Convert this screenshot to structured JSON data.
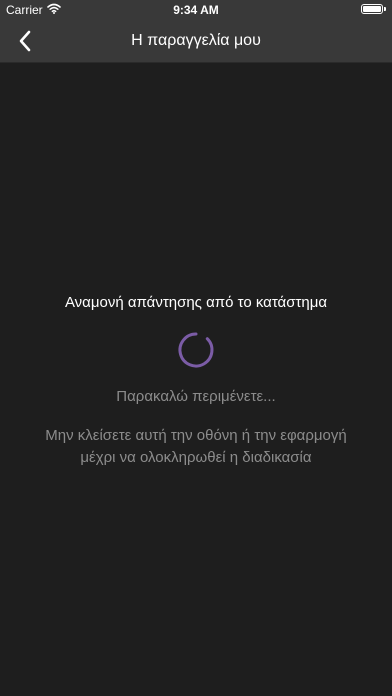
{
  "status_bar": {
    "carrier": "Carrier",
    "time": "9:34 AM",
    "battery_level": 1.0,
    "icons": [
      "wifi-icon",
      "battery-icon"
    ]
  },
  "nav": {
    "title": "Η παραγγελία μου",
    "back_icon": "chevron-left-icon"
  },
  "main": {
    "waiting_title": "Αναμονή απάντησης από το κατάστημα",
    "please_wait": "Παρακαλώ περιμένετε...",
    "warning_lines": [
      "Μην κλείσετε αυτή την οθόνη ή την εφαρμογή",
      "μέχρι να ολοκληρωθεί η διαδικασία"
    ]
  },
  "colors": {
    "background": "#1e1e1e",
    "bar": "#393939",
    "spinner": "#7b5ca6",
    "secondary_text": "#8c8c8c",
    "primary_text": "#ffffff"
  }
}
